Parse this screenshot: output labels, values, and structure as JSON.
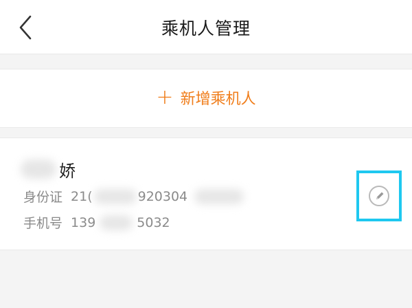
{
  "header": {
    "title": "乘机人管理",
    "back_icon": "chevron-left-icon"
  },
  "add_passenger": {
    "plus_symbol": "+",
    "label": "新增乘机人",
    "color": "#f07d1a"
  },
  "passenger": {
    "name_visible": "娇",
    "id_label": "身份证",
    "id_prefix": "21(",
    "id_middle": "920304",
    "phone_label": "手机号",
    "phone_prefix": "139",
    "phone_suffix": "5032",
    "edit_icon": "pencil-icon",
    "highlight_color": "#1ec8f0"
  }
}
